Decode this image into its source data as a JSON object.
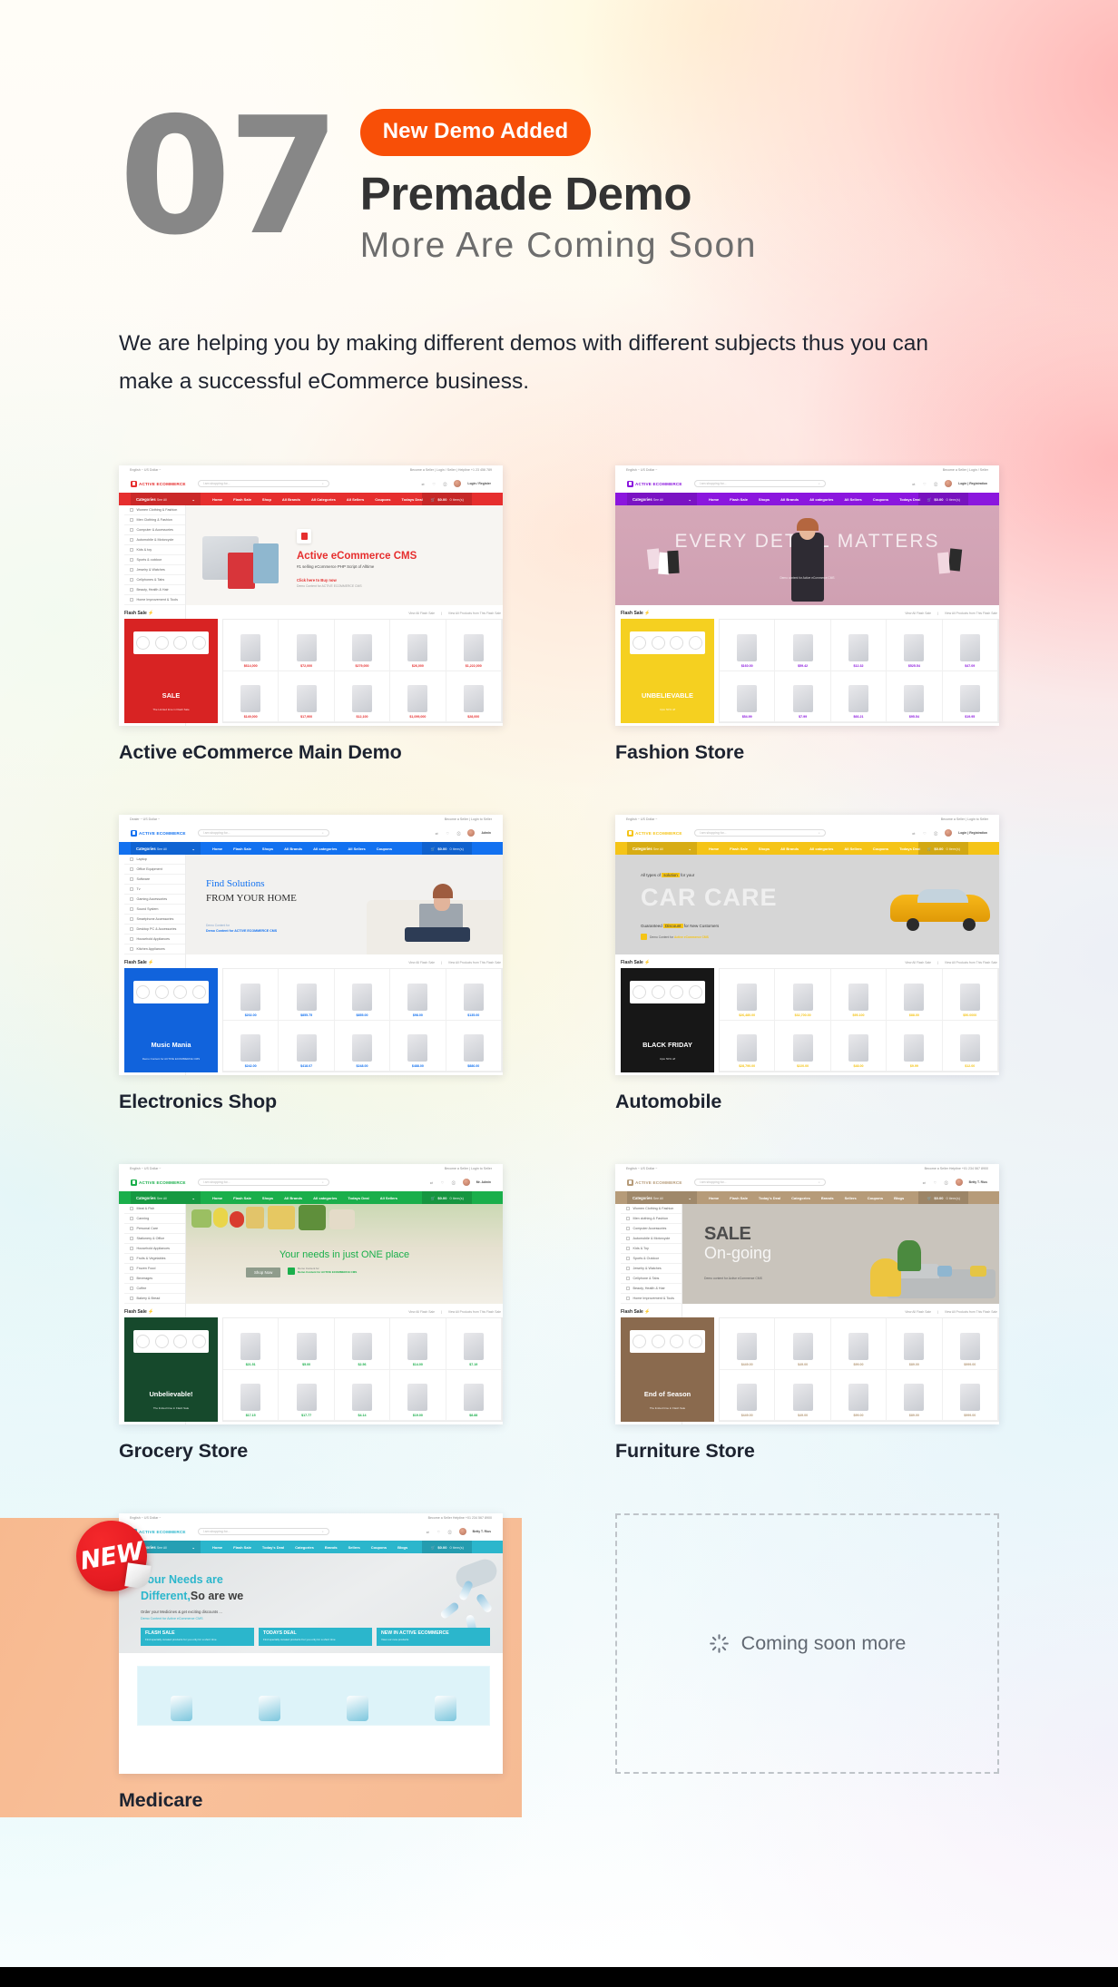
{
  "section": {
    "number": "07",
    "badge_label": "New Demo Added",
    "title": "Premade Demo",
    "subtitle": "More Are Coming Soon",
    "description": "We are helping you by making different demos with different subjects thus you can make a successful eCommerce business.",
    "badge_color": "#f84f07",
    "number_color": "#878787"
  },
  "placeholder": {
    "label": "Coming soon more",
    "icon": "spinner-icon"
  },
  "new_badge": {
    "label": "NEW",
    "color": "#e71d23"
  },
  "demos": [
    {
      "label": "Active eCommerce Main Demo",
      "accent": "#e62e2e",
      "nav_color": "#e62e2e",
      "logo_text": "ACTIVE ECOMMERCE",
      "search_placeholder": "I am shopping for...",
      "topbar_left": "English  ~    US Dollar ~",
      "topbar_right": "Become a Seller  |   Login / Seller   |   Helpline +1 23 456 789",
      "categories_label": "Categories",
      "categories_sub": "See All",
      "nav_links": [
        "Home",
        "Flash Sale",
        "Shop",
        "All Brands",
        "All Categories",
        "All Sellers",
        "Coupons",
        "Todays Deal"
      ],
      "cart_label": "$0.00",
      "cart_items": "0 item(s)",
      "user_name": "Login / Register",
      "sidebar": [
        "Women Clothing & Fashion",
        "Men Clothing & Fashion",
        "Computer & Accessories",
        "Automobile & Motorcycle",
        "Kids & toy",
        "Sports & outdoor",
        "Jewelry & Watches",
        "Cellphones & Tabs",
        "Beauty, Health & Hair",
        "Home Improvement & Tools"
      ],
      "hero_title": "Active eCommerce CMS",
      "hero_sub": "#1 selling eCommerce PHP Script of Alltime",
      "hero_cta": "Click here to Buy now",
      "hero_note": "Demo Content for ACTIVE ECOMMERCE CMS",
      "hero_style": "cart-bags",
      "flash_label": "Flash Sale",
      "flash_link_1": "View All Flash Sale",
      "flash_link_2": "View All Products from This Flash Sale",
      "promo_tag": "SALE",
      "promo_note": "The Limited time in Flash Sale",
      "promo_bg": "#d82323",
      "prices": [
        "$614,000",
        "$72,000",
        "$279,000",
        "$26,000",
        "$1,222,000",
        "$149,000",
        "$17,900",
        "$12,100",
        "$1,099,000",
        "$28,000"
      ]
    },
    {
      "label": "Fashion Store",
      "accent": "#8b16de",
      "nav_color": "#8b16de",
      "logo_text": "ACTIVE ECOMMERCE",
      "search_placeholder": "I am shopping for...",
      "topbar_left": "English  ~    US Dollar ~",
      "topbar_right": "Become a Seller  |   Login / Seller",
      "categories_label": "Categories",
      "categories_sub": "See All",
      "nav_links": [
        "Home",
        "Flash Sale",
        "Shops",
        "All Brands",
        "All categories",
        "All Sellers",
        "Coupons",
        "Todays Deal"
      ],
      "cart_label": "$0.00",
      "cart_items": "0 item(s)",
      "user_name": "Login | Registration",
      "sidebar": [],
      "hero_title": "EVERY DETAIL MATTERS",
      "hero_sub": "",
      "hero_cta": "",
      "hero_note": "Demo content for Active eCommerce CMS",
      "hero_style": "fashion",
      "flash_label": "Flash Sale",
      "flash_link_1": "View All Flash Sale",
      "flash_link_2": "View All Products from This Flash Sale",
      "promo_tag": "UNBELIEVABLE",
      "promo_note": "Upto 50% off",
      "promo_bg": "#f5d020",
      "prices": [
        "$160.00",
        "$59.42",
        "$12.32",
        "$525.54",
        "$47.09",
        "$54.99",
        "$7.99",
        "$66.21",
        "$95.54",
        "$19.95"
      ]
    },
    {
      "label": "Electronics Shop",
      "accent": "#1271f0",
      "nav_color": "#1271f0",
      "logo_text": "ACTIVE ECOMMERCE",
      "search_placeholder": "I am shopping for...",
      "topbar_left": "Dealer ~    US Dollar ~",
      "topbar_right": "Become a Seller  |   Login to Seller",
      "categories_label": "Categories",
      "categories_sub": "See All",
      "nav_links": [
        "Home",
        "Flash Sale",
        "Shops",
        "All Brands",
        "All categories",
        "All Sellers",
        "Coupons"
      ],
      "cart_label": "$0.00",
      "cart_items": "0 item(s)",
      "user_name": "Admin",
      "sidebar": [
        "Laptop",
        "Office Equipment",
        "Software",
        "Tv",
        "Gaming Accessories",
        "Sound System",
        "Smartphone Accessories",
        "Desktop PC & Accessories",
        "Household Appliances",
        "Kitchen Appliances"
      ],
      "hero_title": "Find Solutions",
      "hero_sub": "FROM YOUR HOME",
      "hero_cta": "",
      "hero_note": "Demo Content for ACTIVE ECOMMERCE CMS",
      "hero_style": "electronics",
      "flash_label": "Flash Sale",
      "flash_link_1": "View All Flash Sale",
      "flash_link_2": "View All Products from This Flash Sale",
      "promo_tag": "Music Mania",
      "promo_note": "Demo Content for ACTIVE ECOMMERCE CMS",
      "promo_bg": "#1163dc",
      "prices": [
        "$202.00",
        "$855.75",
        "$855.00",
        "$98.00",
        "$135.00",
        "$242.00",
        "$418.07",
        "$248.00",
        "$488.00",
        "$886.00"
      ]
    },
    {
      "label": "Automobile",
      "accent": "#f5c417",
      "nav_color": "#f5c417",
      "logo_text": "ACTIVE ECOMMERCE",
      "search_placeholder": "I am shopping for...",
      "topbar_left": "English  ~    US Dollar ~",
      "topbar_right": "Become a Seller  |   Login to Seller",
      "categories_label": "Categories",
      "categories_sub": "See All",
      "nav_links": [
        "Home",
        "Flash Sale",
        "Shops",
        "All Brands",
        "All categories",
        "All Sellers",
        "Coupons",
        "Todays Deal"
      ],
      "cart_label": "$0.00",
      "cart_items": "0 item(s)",
      "user_name": "Login | Registration",
      "sidebar": [],
      "hero_title": "CAR CARE",
      "hero_sub": "All types of solution for your",
      "hero_cta": "Guaranteed Discount for New Customers",
      "hero_note": "Demo Content for Active eCommerce CMS",
      "hero_style": "automobile",
      "flash_label": "Flash Sale",
      "flash_link_1": "View All Flash Sale",
      "flash_link_2": "View All Products from This Flash Sale",
      "promo_tag": "BLACK FRIDAY",
      "promo_note": "Upto 50% off",
      "promo_bg": "#171717",
      "prices": [
        "$26,480.00",
        "$32,700.00",
        "$95.100",
        "$88.00",
        "$50.0000",
        "$28,790.00",
        "$220.00",
        "$48.00",
        "$9.99",
        "$12.00"
      ]
    },
    {
      "label": "Grocery Store",
      "accent": "#1aaf4b",
      "nav_color": "#1aaf4b",
      "logo_text": "ACTIVE ECOMMERCE",
      "search_placeholder": "I am shopping for...",
      "topbar_left": "English  ~    US Dollar ~",
      "topbar_right": "Become a Seller  |   Login to Seller",
      "categories_label": "Categories",
      "categories_sub": "See All",
      "nav_links": [
        "Home",
        "Flash Sale",
        "Shops",
        "All Brands",
        "All categories",
        "Todays Deal",
        "All Sellers"
      ],
      "cart_label": "$0.00",
      "cart_items": "0 item(s)",
      "user_name": "Mr. Admin",
      "sidebar": [
        "Meat & Fish",
        "Canning",
        "Personal Care",
        "Stationery & Office",
        "Household Appliances",
        "Fruits & Vegetables",
        "Frozen Food",
        "Beverages",
        "Coffee",
        "Bakery & Bread"
      ],
      "hero_title": "Your needs in just ONE place",
      "hero_sub": "",
      "hero_cta": "Shop Now",
      "hero_note": "Demo Content for ACTIVE ECOMMERCE CMS",
      "hero_style": "grocery",
      "flash_label": "Flash Sale",
      "flash_link_1": "View All Flash Sale",
      "flash_link_2": "View All Products from This Flash Sale",
      "promo_tag": "Unbelievable!",
      "promo_note": "The limited time in Flash Sale",
      "promo_bg": "#16492c",
      "prices": [
        "$21.51",
        "$5.00",
        "$2.56",
        "$14.00",
        "$7.19",
        "$17.15",
        "$17.77",
        "$4.14",
        "$19.00",
        "$8.88"
      ]
    },
    {
      "label": "Furniture Store",
      "accent": "#b69b79",
      "nav_color": "#b69b79",
      "logo_text": "ACTIVE ECOMMERCE",
      "search_placeholder": "I am shopping for...",
      "topbar_left": "English  ~    US Dollar ~",
      "topbar_right": "Become a Seller    Helpline +01 234 567 8900",
      "categories_label": "Categories",
      "categories_sub": "See All",
      "nav_links": [
        "Home",
        "Flash Sale",
        "Today's Deal",
        "Categories",
        "Brands",
        "Sellers",
        "Coupons",
        "Blogs"
      ],
      "cart_label": "$0.00",
      "cart_items": "0 item(s)",
      "user_name": "Betty T. Rius",
      "sidebar": [
        "Women Clothing & Fashion",
        "Men clothing & Fashion",
        "Computer Accessories",
        "Automobile & Motorcycle",
        "Kids & Toy",
        "Sports & Outdoor",
        "Jewelry & Watches",
        "Cellphone & Tabs",
        "Beauty, Health & Hair",
        "Home Improvement & Tools"
      ],
      "hero_title": "SALE",
      "hero_sub": "On-going",
      "hero_cta": "",
      "hero_note": "Demo content for Active eCommerce CMS",
      "hero_style": "furniture",
      "flash_label": "Flash Sale",
      "flash_link_1": "View All Flash Sale",
      "flash_link_2": "View All Products from This Flash Sale",
      "promo_tag": "End of Season",
      "promo_note": "The limited time in Flash Sale",
      "promo_bg": "#8a6a4e",
      "prices": [
        "$449.00",
        "$49.00",
        "$99.00",
        "$89.00",
        "$999.00",
        "$449.00",
        "$49.00",
        "$99.00",
        "$89.00",
        "$999.00"
      ]
    },
    {
      "label": "Medicare",
      "accent": "#2bb6cc",
      "nav_color": "#2bb6cc",
      "logo_text": "ACTIVE ECOMMERCE",
      "search_placeholder": "I am shopping for...",
      "topbar_left": "English  ~    US Dollar ~",
      "topbar_right": "Become a Seller    Helpline +01 234 567 8900",
      "categories_label": "Categories",
      "categories_sub": "See All",
      "nav_links": [
        "Home",
        "Flash Sale",
        "Today's Deal",
        "Categories",
        "Brands",
        "Sellers",
        "Coupons",
        "Blogs"
      ],
      "cart_label": "$0.00",
      "cart_items": "0 item(s)",
      "user_name": "Betty T. Rius",
      "sidebar": [],
      "hero_title": "Your Needs are",
      "hero_title_2": "Different,",
      "hero_title_3": "So are we",
      "hero_sub": "Order your Medicines & get exciting discounts ...",
      "hero_cta": "Demo Content for Active eCommerce CMS",
      "hero_note": "",
      "hero_style": "medicare",
      "hero_cards": [
        {
          "title": "FLASH SALE",
          "sub": "Find specially curated products for you only for a short time"
        },
        {
          "title": "TODAYS DEAL",
          "sub": "Find specially curated products For you only for a short time"
        },
        {
          "title": "NEW IN ACTIVE ECOMMERCE",
          "sub": "View our new products"
        }
      ],
      "flash_label": "",
      "flash_link_1": "",
      "flash_link_2": "",
      "promo_tag": "",
      "promo_note": "",
      "promo_bg": "#2bb6cc",
      "prices": []
    }
  ]
}
